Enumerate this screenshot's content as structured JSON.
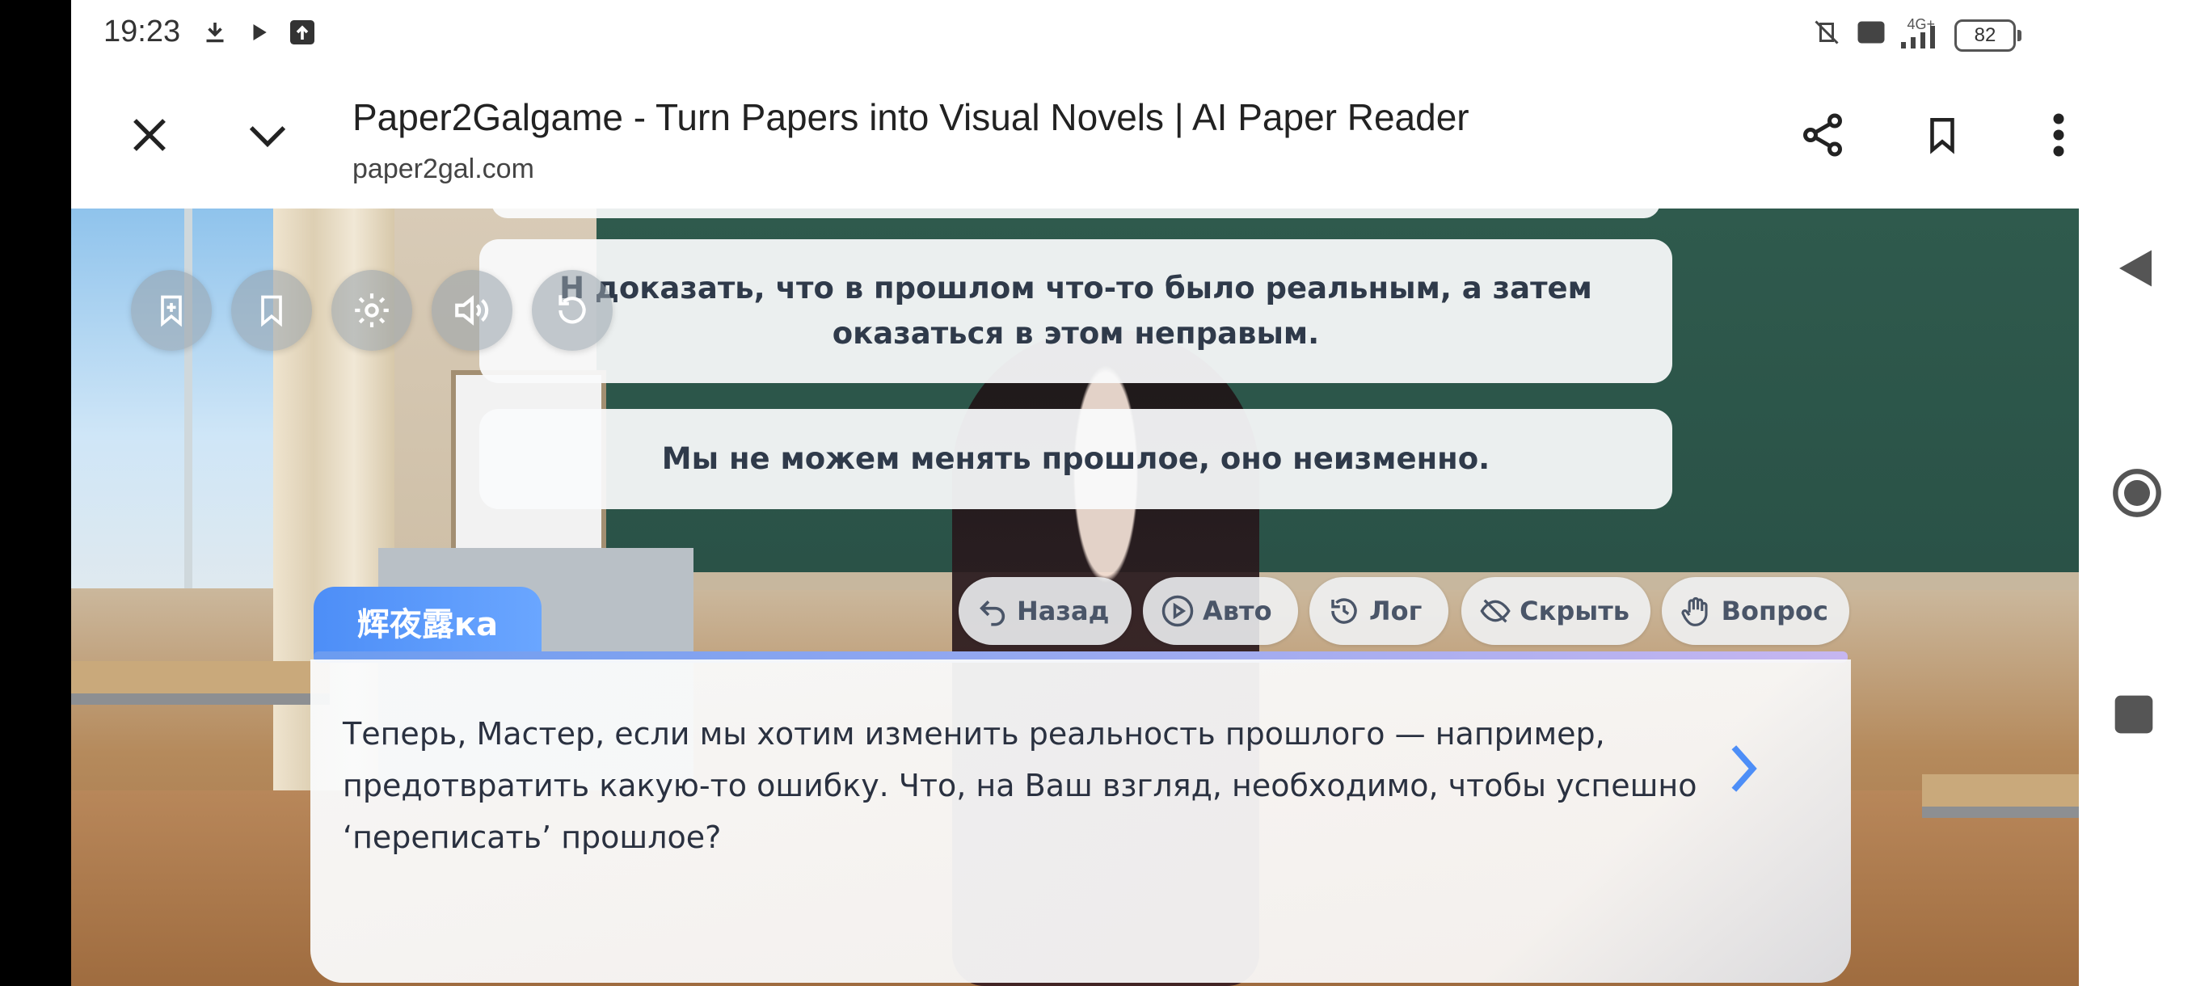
{
  "status_bar": {
    "time": "19:23",
    "battery": "82",
    "network": "4G+"
  },
  "browser": {
    "title": "Paper2Galgame - Turn Papers into Visual Novels | AI Paper Reader",
    "domain": "paper2gal.com",
    "icons": [
      "close-icon",
      "chevron-down-icon",
      "share-icon",
      "bookmark-icon",
      "more-vert-icon"
    ]
  },
  "game": {
    "quick_icons": [
      "bookmark-add-icon",
      "bookmark-icon",
      "gear-icon",
      "volume-icon",
      "restart-icon"
    ],
    "choices": [
      "Н  доказать, что в прошлом что-то было реальным, а затем оказаться в этом неправым.",
      "Мы не можем менять прошлое, оно неизменно."
    ],
    "toolbar": {
      "back": "Назад",
      "auto": "Авто",
      "log": "Лог",
      "hide": "Скрыть",
      "question": "Вопрос"
    },
    "speaker": "辉夜露ка",
    "dialog": "Теперь, Мастер, если мы хотим изменить реальность прошлого — например, предотвратить какую-то ошибку. Что, на Ваш взгляд, необходимо, чтобы успешно ‘переписать’ прошлое?"
  },
  "colors": {
    "accent": "#4d8ef7",
    "text_dark": "#2f3a4a"
  }
}
